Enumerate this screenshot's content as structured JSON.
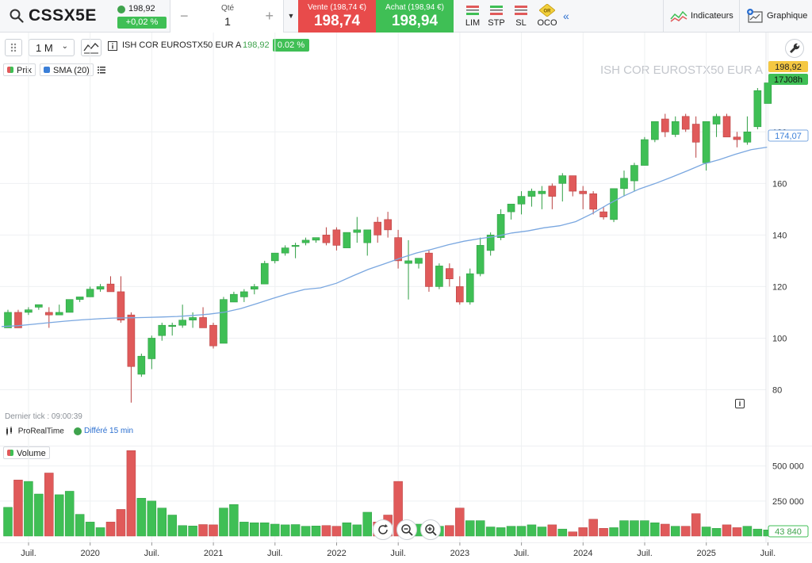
{
  "toolbar": {
    "ticker": "CSSX5E",
    "quote_price": "198,92",
    "quote_change": "+0,02 %",
    "qty_label": "Qté",
    "qty_value": "1",
    "qty_minus": "−",
    "qty_plus": "+",
    "sell_caption": "Vente (198,74 €)",
    "sell_price": "198,74",
    "buy_caption": "Achat (198,94 €)",
    "buy_price": "198,94",
    "order_types": [
      "LIM",
      "STP",
      "SL",
      "OCO"
    ],
    "oco_badge": "OR",
    "indicators_label": "Indicateurs",
    "graphic_label": "Graphique"
  },
  "chart_toolbar": {
    "period": "1 M",
    "instrument": "ISH COR EUROSTX50 EUR A",
    "price": "198,92",
    "change": "0.02 %"
  },
  "legend": {
    "price_label": "Prix",
    "sma_label": "SMA (20)",
    "volume_label": "Volume"
  },
  "watermark": "ISH COR EUROSTX50 EUR A",
  "status": {
    "last_tick": "Dernier tick : 09:00:39",
    "provider": "ProRealTime",
    "delay": "Différé 15 min"
  },
  "price_axis": {
    "ticks": [
      "80",
      "100",
      "120",
      "140",
      "160",
      "180"
    ],
    "last_price": "198,92",
    "countdown": "17J08h",
    "sma_value": "174,07"
  },
  "volume_axis": {
    "ticks": [
      "250 000",
      "500 000"
    ],
    "last_volume": "43 840"
  },
  "time_axis": [
    "Juil.",
    "2020",
    "Juil.",
    "2021",
    "Juil.",
    "2022",
    "Juil.",
    "2023",
    "Juil.",
    "2024",
    "Juil.",
    "2025",
    "Juil."
  ],
  "colors": {
    "up": "#3fbf55",
    "down": "#e05a5a",
    "sma": "#7aa7e0",
    "accent": "#2b6fd0"
  },
  "chart_data": {
    "type": "candlestick",
    "price_ylim": [
      74,
      205
    ],
    "volume_ylim": [
      0,
      600000
    ],
    "candles": [
      {
        "o": 104,
        "h": 111,
        "l": 104,
        "c": 110,
        "v": 205000
      },
      {
        "o": 110,
        "h": 111,
        "l": 104,
        "c": 104,
        "v": 400000
      },
      {
        "o": 110,
        "h": 112,
        "l": 109,
        "c": 111,
        "v": 390000
      },
      {
        "o": 112,
        "h": 113,
        "l": 111,
        "c": 113,
        "v": 300000
      },
      {
        "o": 110,
        "h": 112,
        "l": 104,
        "c": 109,
        "v": 450000
      },
      {
        "o": 109,
        "h": 113,
        "l": 109,
        "c": 110,
        "v": 295000
      },
      {
        "o": 110,
        "h": 115,
        "l": 110,
        "c": 115,
        "v": 320000
      },
      {
        "o": 115,
        "h": 116,
        "l": 114,
        "c": 116,
        "v": 155000
      },
      {
        "o": 116,
        "h": 120,
        "l": 116,
        "c": 119,
        "v": 100000
      },
      {
        "o": 119,
        "h": 121,
        "l": 118,
        "c": 120,
        "v": 60000
      },
      {
        "o": 121,
        "h": 124,
        "l": 118,
        "c": 118,
        "v": 100000
      },
      {
        "o": 118,
        "h": 124,
        "l": 106,
        "c": 107,
        "v": 190000
      },
      {
        "o": 109,
        "h": 110,
        "l": 75,
        "c": 89,
        "v": 610000
      },
      {
        "o": 86,
        "h": 94,
        "l": 85,
        "c": 93,
        "v": 270000
      },
      {
        "o": 92,
        "h": 101,
        "l": 88,
        "c": 100,
        "v": 250000
      },
      {
        "o": 101,
        "h": 106,
        "l": 99,
        "c": 105,
        "v": 200000
      },
      {
        "o": 105,
        "h": 106,
        "l": 101,
        "c": 105,
        "v": 150000
      },
      {
        "o": 105,
        "h": 113,
        "l": 104,
        "c": 107,
        "v": 75000
      },
      {
        "o": 107,
        "h": 110,
        "l": 104,
        "c": 108,
        "v": 72000
      },
      {
        "o": 108,
        "h": 112,
        "l": 105,
        "c": 104,
        "v": 82000
      },
      {
        "o": 105,
        "h": 106,
        "l": 96,
        "c": 97,
        "v": 80000
      },
      {
        "o": 98,
        "h": 116,
        "l": 98,
        "c": 115,
        "v": 200000
      },
      {
        "o": 114,
        "h": 118,
        "l": 114,
        "c": 117,
        "v": 225000
      },
      {
        "o": 116,
        "h": 119,
        "l": 114,
        "c": 118,
        "v": 100000
      },
      {
        "o": 119,
        "h": 121,
        "l": 117,
        "c": 120,
        "v": 95000
      },
      {
        "o": 121,
        "h": 130,
        "l": 121,
        "c": 129,
        "v": 95000
      },
      {
        "o": 130,
        "h": 133,
        "l": 129,
        "c": 133,
        "v": 85000
      },
      {
        "o": 133,
        "h": 136,
        "l": 132,
        "c": 135,
        "v": 80000
      },
      {
        "o": 136,
        "h": 137,
        "l": 131,
        "c": 136,
        "v": 82000
      },
      {
        "o": 137,
        "h": 139,
        "l": 136,
        "c": 138,
        "v": 70000
      },
      {
        "o": 138,
        "h": 139,
        "l": 137,
        "c": 139,
        "v": 72000
      },
      {
        "o": 140,
        "h": 143,
        "l": 136,
        "c": 137,
        "v": 75000
      },
      {
        "o": 142,
        "h": 143,
        "l": 134,
        "c": 136,
        "v": 70000
      },
      {
        "o": 135,
        "h": 141,
        "l": 135,
        "c": 141,
        "v": 95000
      },
      {
        "o": 141,
        "h": 147,
        "l": 137,
        "c": 142,
        "v": 80000
      },
      {
        "o": 137,
        "h": 139,
        "l": 132,
        "c": 142,
        "v": 170000
      },
      {
        "o": 145,
        "h": 147,
        "l": 137,
        "c": 140,
        "v": 100000
      },
      {
        "o": 146,
        "h": 149,
        "l": 139,
        "c": 142,
        "v": 150000
      },
      {
        "o": 139,
        "h": 142,
        "l": 127,
        "c": 130,
        "v": 390000
      },
      {
        "o": 129,
        "h": 138,
        "l": 115,
        "c": 130,
        "v": 100000
      },
      {
        "o": 129,
        "h": 131,
        "l": 127,
        "c": 131,
        "v": 85000
      },
      {
        "o": 133,
        "h": 134,
        "l": 118,
        "c": 120,
        "v": 70000
      },
      {
        "o": 120,
        "h": 129,
        "l": 119,
        "c": 128,
        "v": 70000
      },
      {
        "o": 127,
        "h": 129,
        "l": 120,
        "c": 123,
        "v": 75000
      },
      {
        "o": 120,
        "h": 124,
        "l": 113,
        "c": 114,
        "v": 200000
      },
      {
        "o": 114,
        "h": 127,
        "l": 113,
        "c": 125,
        "v": 110000
      },
      {
        "o": 125,
        "h": 139,
        "l": 124,
        "c": 136,
        "v": 110000
      },
      {
        "o": 134,
        "h": 141,
        "l": 132,
        "c": 140,
        "v": 65000
      },
      {
        "o": 139,
        "h": 150,
        "l": 138,
        "c": 148,
        "v": 60000
      },
      {
        "o": 149,
        "h": 152,
        "l": 146,
        "c": 152,
        "v": 70000
      },
      {
        "o": 152,
        "h": 157,
        "l": 148,
        "c": 155,
        "v": 70000
      },
      {
        "o": 155,
        "h": 158,
        "l": 151,
        "c": 157,
        "v": 80000
      },
      {
        "o": 156,
        "h": 159,
        "l": 150,
        "c": 157,
        "v": 65000
      },
      {
        "o": 159,
        "h": 160,
        "l": 150,
        "c": 155,
        "v": 80000
      },
      {
        "o": 160,
        "h": 164,
        "l": 153,
        "c": 163,
        "v": 50000
      },
      {
        "o": 163,
        "h": 163,
        "l": 155,
        "c": 157,
        "v": 30000
      },
      {
        "o": 157,
        "h": 159,
        "l": 150,
        "c": 156,
        "v": 60000
      },
      {
        "o": 156,
        "h": 157,
        "l": 148,
        "c": 150,
        "v": 120000
      },
      {
        "o": 149,
        "h": 151,
        "l": 146,
        "c": 147,
        "v": 55000
      },
      {
        "o": 146,
        "h": 158,
        "l": 145,
        "c": 158,
        "v": 60000
      },
      {
        "o": 158,
        "h": 165,
        "l": 155,
        "c": 162,
        "v": 110000
      },
      {
        "o": 161,
        "h": 168,
        "l": 157,
        "c": 167,
        "v": 110000
      },
      {
        "o": 167,
        "h": 178,
        "l": 167,
        "c": 177,
        "v": 110000
      },
      {
        "o": 177,
        "h": 184,
        "l": 176,
        "c": 184,
        "v": 95000
      },
      {
        "o": 185,
        "h": 187,
        "l": 178,
        "c": 180,
        "v": 85000
      },
      {
        "o": 179,
        "h": 186,
        "l": 178,
        "c": 184,
        "v": 70000
      },
      {
        "o": 186,
        "h": 187,
        "l": 180,
        "c": 181,
        "v": 70000
      },
      {
        "o": 183,
        "h": 186,
        "l": 170,
        "c": 176,
        "v": 160000
      },
      {
        "o": 168,
        "h": 184,
        "l": 165,
        "c": 184,
        "v": 65000
      },
      {
        "o": 183,
        "h": 187,
        "l": 178,
        "c": 186,
        "v": 55000
      },
      {
        "o": 186,
        "h": 187,
        "l": 178,
        "c": 178,
        "v": 80000
      },
      {
        "o": 178,
        "h": 180,
        "l": 174,
        "c": 177,
        "v": 60000
      },
      {
        "o": 176,
        "h": 186,
        "l": 175,
        "c": 180,
        "v": 70000
      },
      {
        "o": 182,
        "h": 197,
        "l": 181,
        "c": 196,
        "v": 50000
      },
      {
        "o": 191,
        "h": 199,
        "l": 191,
        "c": 199,
        "v": 43840
      }
    ],
    "sma": [
      104.5,
      104.8,
      105.4,
      106,
      106.6,
      107.1,
      107.5,
      107.8,
      107.9,
      108,
      108.2,
      108.4,
      108.8,
      109.3,
      110.1,
      111.5,
      113.4,
      115.4,
      117.3,
      118.9,
      119.5,
      121.3,
      124.1,
      126.7,
      128.8,
      131,
      133,
      134.5,
      136.2,
      137.6,
      138.6,
      139.5,
      140.8,
      141.6,
      142.8,
      143.6,
      145.2,
      148.2,
      151.8,
      155.1,
      157.9,
      160,
      162.4,
      164.9,
      167.5,
      169.2,
      171.3,
      173.1,
      174.07
    ],
    "sma_start_index": 26,
    "xlabels": [
      "Juil.",
      "2020",
      "Juil.",
      "2021",
      "Juil.",
      "2022",
      "Juil.",
      "2023",
      "Juil.",
      "2024",
      "Juil.",
      "2025",
      "Juil."
    ]
  }
}
